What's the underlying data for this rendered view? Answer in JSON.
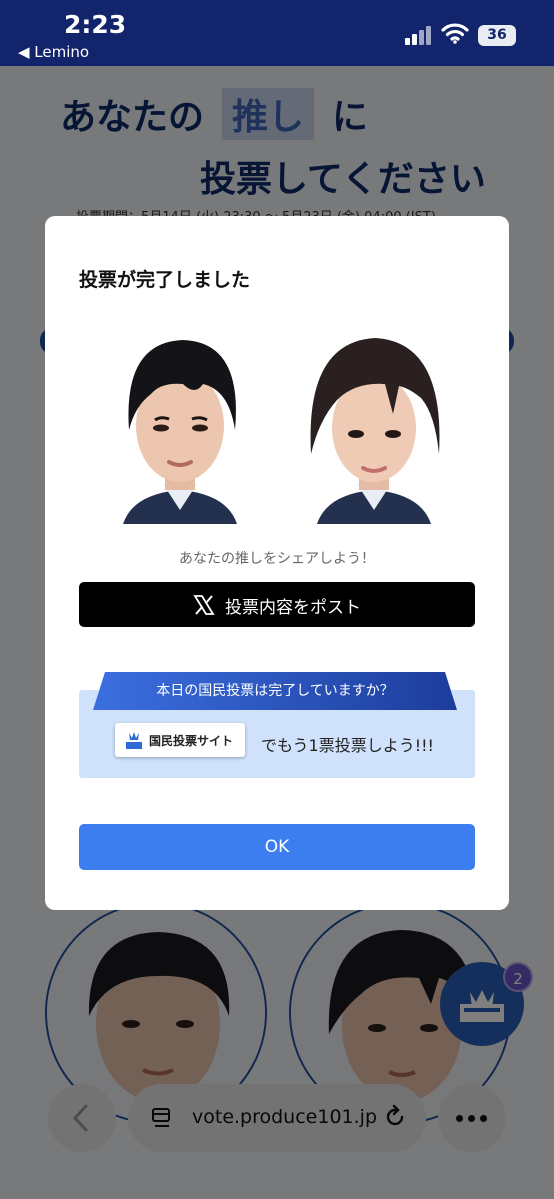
{
  "status_bar": {
    "time": "2:23",
    "back_app": "◀ Lemino",
    "battery": "36"
  },
  "page": {
    "title_prefix": "あなたの",
    "title_highlight": "推し",
    "title_suffix": "に",
    "title_line2": "投票してください",
    "period": "投票期間：5月14日 (火) 23:30 ～ 5月23日 (金) 04:00 (JST)",
    "fab_badge": "2"
  },
  "modal": {
    "title": "投票が完了しました",
    "share_text": "あなたの推しをシェアしよう！",
    "post_button": "投票内容をポスト",
    "ribbon_text": "本日の国民投票は完了していますか？",
    "site_badge": "国民投票サイト",
    "vote_more": "でもう1票投票しよう!!!",
    "ok_button": "OK"
  },
  "browser": {
    "url": "vote.produce101.jp"
  },
  "colors": {
    "status_bar": "#12246c",
    "title": "#0e2b6b",
    "accent": "#3c7ef0",
    "vote_box": "#cfe1fb"
  }
}
